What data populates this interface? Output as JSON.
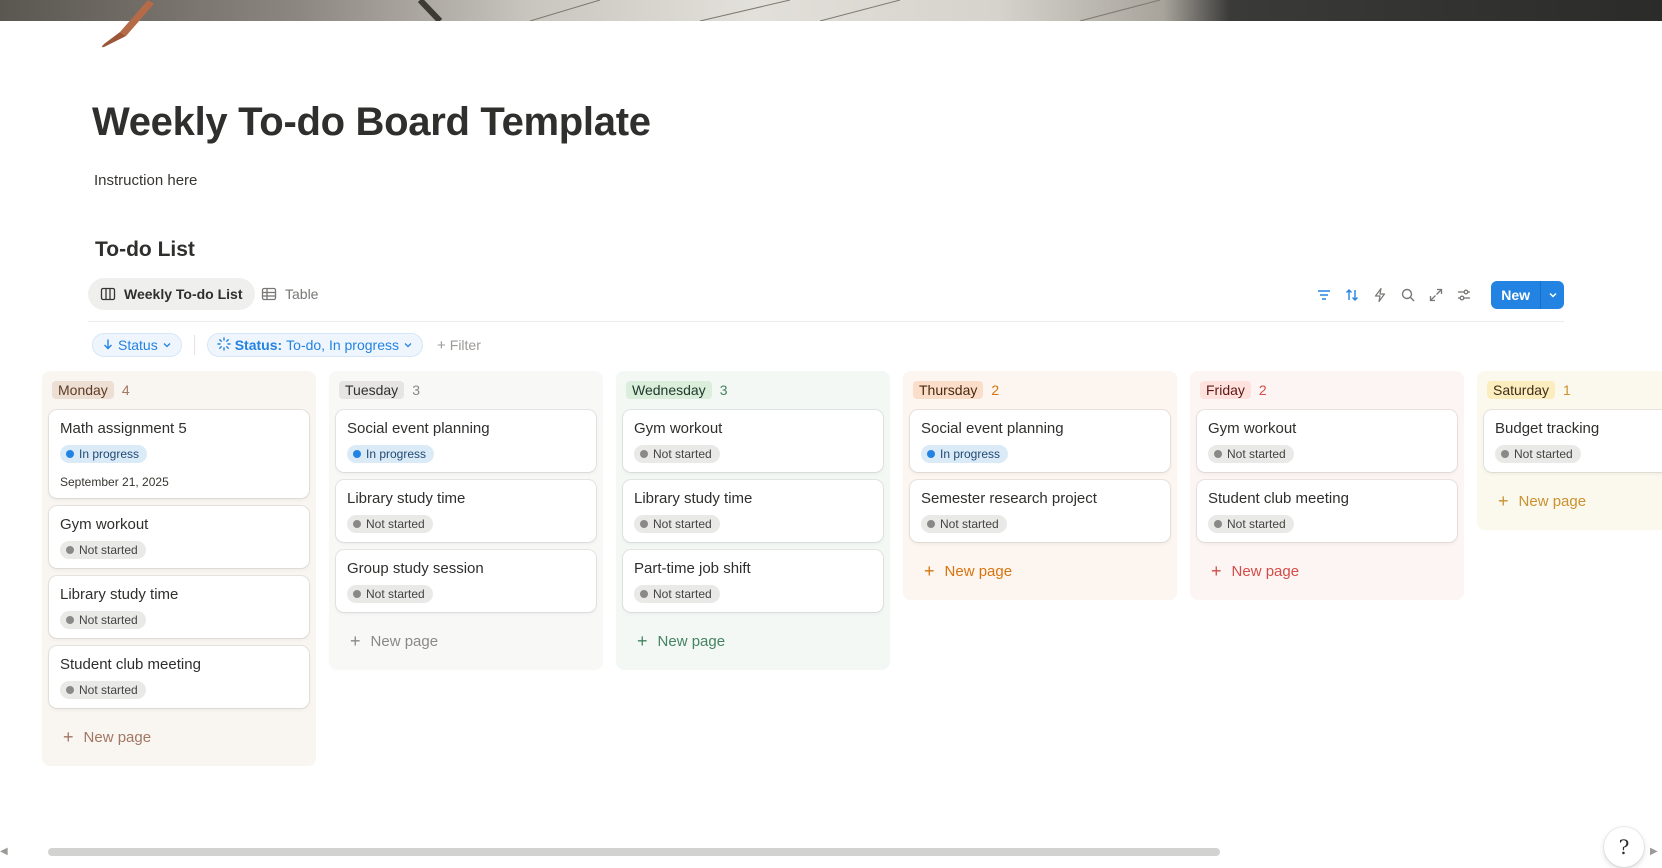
{
  "page": {
    "title": "Weekly To-do Board Template",
    "instruction": "Instruction here"
  },
  "database": {
    "title": "To-do List",
    "views": [
      {
        "label": "Weekly To-do List",
        "icon": "board-icon",
        "active": true
      },
      {
        "label": "Table",
        "icon": "table-icon",
        "active": false
      }
    ],
    "toolbar": {
      "icons": [
        "filter-icon",
        "sort-icon",
        "automation-icon",
        "search-icon",
        "expand-icon",
        "settings-icon"
      ],
      "new_label": "New"
    },
    "filters": {
      "sort_label": "Status",
      "status_key": "Status:",
      "status_value": "To-do, In progress",
      "add_filter_label": "Filter"
    }
  },
  "board": {
    "new_page_label": "New page",
    "columns": [
      {
        "name": "Monday",
        "count": "4",
        "colors": {
          "bg": "#f9f5f1",
          "tag_bg": "#eedfd5",
          "tag_text": "#5c3b23",
          "count": "#a27763",
          "new": "#a27763"
        },
        "cards": [
          {
            "title": "Math assignment 5",
            "status": "In progress",
            "date": "September 21, 2025"
          },
          {
            "title": "Gym workout",
            "status": "Not started"
          },
          {
            "title": "Library study time",
            "status": "Not started"
          },
          {
            "title": "Student club meeting",
            "status": "Not started"
          }
        ]
      },
      {
        "name": "Tuesday",
        "count": "3",
        "colors": {
          "bg": "#f8f8f7",
          "tag_bg": "#e6e5e3",
          "tag_text": "#32302c",
          "count": "#8a8986",
          "new": "#8a8986"
        },
        "cards": [
          {
            "title": "Social event planning",
            "status": "In progress"
          },
          {
            "title": "Library study time",
            "status": "Not started"
          },
          {
            "title": "Group study session",
            "status": "Not started"
          }
        ]
      },
      {
        "name": "Wednesday",
        "count": "3",
        "colors": {
          "bg": "#f4f8f5",
          "tag_bg": "#dbeddb",
          "tag_text": "#1c3829",
          "count": "#448361",
          "new": "#448361"
        },
        "cards": [
          {
            "title": "Gym workout",
            "status": "Not started"
          },
          {
            "title": "Library study time",
            "status": "Not started"
          },
          {
            "title": "Part-time job shift",
            "status": "Not started"
          }
        ]
      },
      {
        "name": "Thursday",
        "count": "2",
        "colors": {
          "bg": "#fcf5f0",
          "tag_bg": "#fadec9",
          "tag_text": "#49290e",
          "count": "#d9730d",
          "new": "#d9730d"
        },
        "cards": [
          {
            "title": "Social event planning",
            "status": "In progress"
          },
          {
            "title": "Semester research project",
            "status": "Not started"
          }
        ]
      },
      {
        "name": "Friday",
        "count": "2",
        "colors": {
          "bg": "#fdf5f3",
          "tag_bg": "#ffe2dd",
          "tag_text": "#5d1715",
          "count": "#d44c47",
          "new": "#d44c47"
        },
        "cards": [
          {
            "title": "Gym workout",
            "status": "Not started"
          },
          {
            "title": "Student club meeting",
            "status": "Not started"
          }
        ]
      },
      {
        "name": "Saturday",
        "count": "1",
        "colors": {
          "bg": "#fbf8ee",
          "tag_bg": "#fbedbe",
          "tag_text": "#402c1b",
          "count": "#cb912f",
          "new": "#cb912f"
        },
        "cards": [
          {
            "title": "Budget tracking",
            "status": "Not started"
          }
        ]
      }
    ]
  },
  "help": {
    "label": "?"
  }
}
